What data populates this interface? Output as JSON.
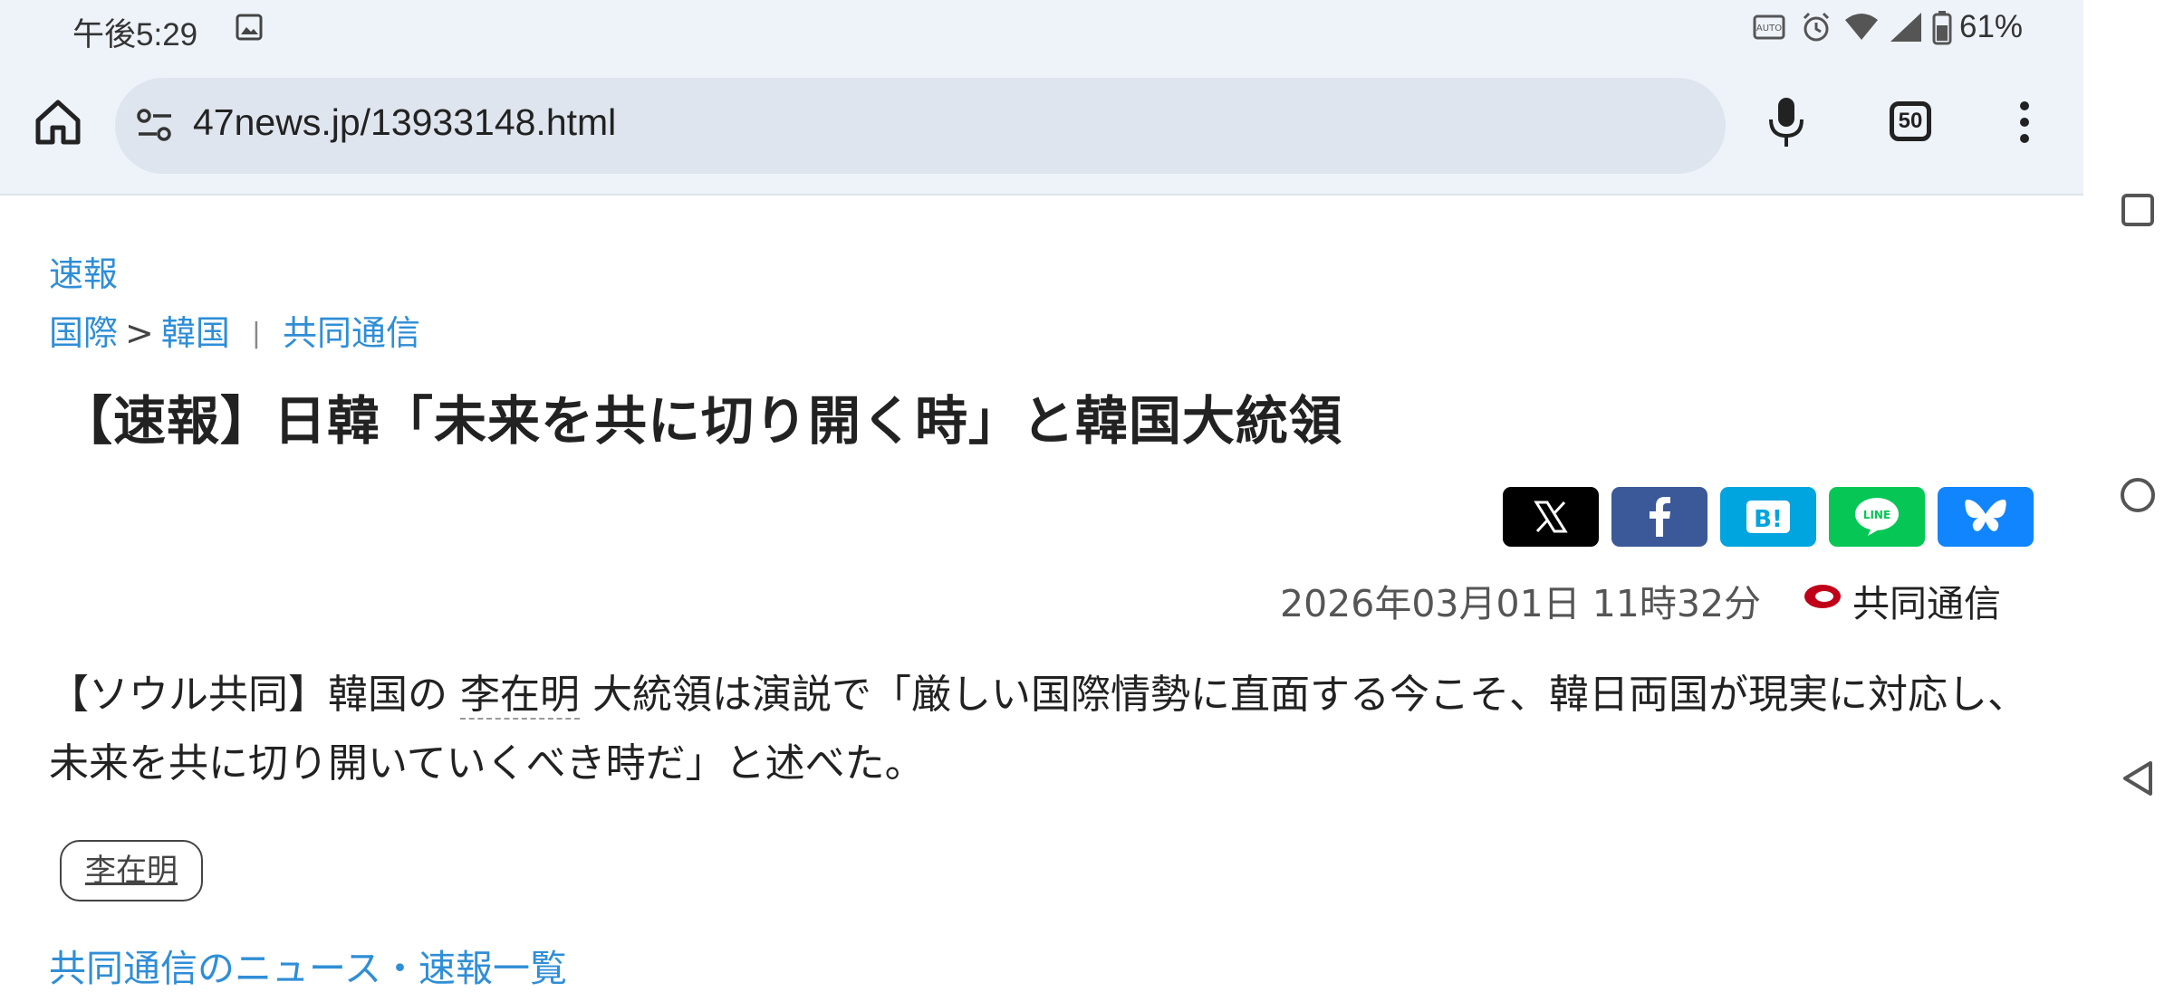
{
  "status_bar": {
    "time": "午後5:29",
    "battery": "61%"
  },
  "browser": {
    "url": "47news.jp/13933148.html",
    "tab_count": "50"
  },
  "article": {
    "breaking_label": "速報",
    "breadcrumb": {
      "category": "国際",
      "separator": ">",
      "subcategory": "韓国",
      "source": "共同通信"
    },
    "headline": "【速報】日韓「未来を共に切り開く時」と韓国大統領",
    "share_buttons": [
      "x-share",
      "facebook-share",
      "hatena-bookmark-share",
      "line-share",
      "bluesky-share"
    ],
    "datetime": "2026年03月01日 11時32分",
    "source": "共同通信",
    "body_prefix": "【ソウル共同】韓国の",
    "body_person": "李在明",
    "body_suffix": "大統領は演説で「厳しい国際情勢に直面する今こそ、韓日両国が現実に対応し、未来を共に切り開いていくべき時だ」と述べた。",
    "tag": "李在明",
    "more_news_link": "共同通信のニュース・速報一覧"
  },
  "colors": {
    "link": "#2f8ed6",
    "x": "#000000",
    "facebook": "#3b5998",
    "hatena": "#00a4de",
    "line": "#06c755",
    "bluesky": "#1185fe"
  }
}
